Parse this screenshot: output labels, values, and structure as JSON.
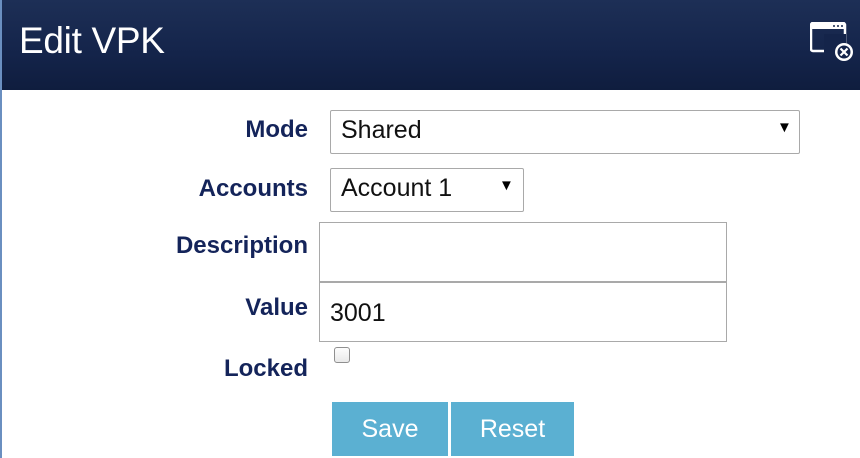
{
  "dialog": {
    "title": "Edit VPK",
    "close_icon": "close-window-icon"
  },
  "form": {
    "mode": {
      "label": "Mode",
      "value": "Shared"
    },
    "accounts": {
      "label": "Accounts",
      "value": "Account 1"
    },
    "description": {
      "label": "Description",
      "value": ""
    },
    "value": {
      "label": "Value",
      "value": "3001"
    },
    "locked": {
      "label": "Locked",
      "checked": false
    }
  },
  "buttons": {
    "save": "Save",
    "reset": "Reset"
  },
  "colors": {
    "titlebar": "#14244a",
    "label_text": "#14245a",
    "button_bg": "#5bb0d2"
  }
}
